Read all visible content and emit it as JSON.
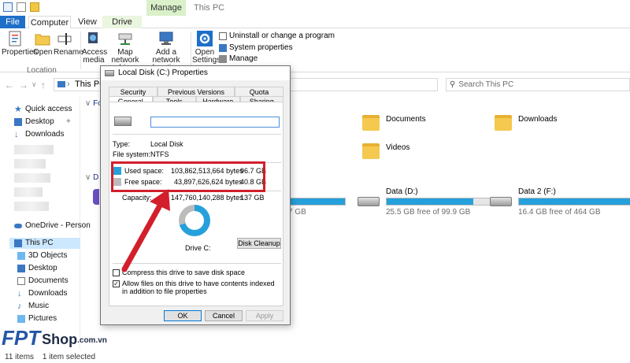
{
  "window": {
    "title": "This PC",
    "context_tab": "Manage"
  },
  "ribbon_tabs": {
    "file": "File",
    "computer": "Computer",
    "view": "View",
    "drive_tools": "Drive Tools"
  },
  "ribbon": {
    "properties": "Properties",
    "open": "Open",
    "rename": "Rename",
    "access_media": "Access media",
    "map_network_drive": "Map network drive",
    "add_network_location": "Add a network location",
    "open_settings": "Open Settings",
    "uninstall": "Uninstall or change a program",
    "system_properties": "System properties",
    "manage": "Manage",
    "group_location": "Location"
  },
  "address": {
    "path": "This PC",
    "search_placeholder": "Search This PC"
  },
  "nav": {
    "quick_access": "Quick access",
    "desktop": "Desktop",
    "downloads": "Downloads",
    "onedrive": "OneDrive - Person",
    "this_pc": "This PC",
    "objects3d": "3D Objects",
    "desktop2": "Desktop",
    "documents": "Documents",
    "downloads2": "Downloads",
    "music": "Music",
    "pictures": "Pictures"
  },
  "content": {
    "section_folders": "Fo",
    "section_devices": "D",
    "folder_documents": "Documents",
    "folder_downloads": "Downloads",
    "folder_videos": "Videos"
  },
  "drives": [
    {
      "name": "",
      "free": "7 GB",
      "fill_pct": 70
    },
    {
      "name": "Data (D:)",
      "free": "25.5 GB free of 99.9 GB",
      "fill_pct": 74
    },
    {
      "name": "Data 2 (F:)",
      "free": "16.4 GB free of 464 GB",
      "fill_pct": 96
    }
  ],
  "status": {
    "items": "11 items",
    "selected": "1 item selected"
  },
  "dialog": {
    "title": "Local Disk (C:) Properties",
    "tabs_top": [
      "Security",
      "Previous Versions",
      "Quota"
    ],
    "tabs_bottom": [
      "General",
      "Tools",
      "Hardware",
      "Sharing"
    ],
    "name_value": "",
    "type_label": "Type:",
    "type_value": "Local Disk",
    "fs_label": "File system:",
    "fs_value": "NTFS",
    "used_label": "Used space:",
    "used_bytes": "103,862,513,664 bytes",
    "used_gb": "96.7 GB",
    "free_label": "Free space:",
    "free_bytes": "43,897,626,624 bytes",
    "free_gb": "40.8 GB",
    "capacity_label": "Capacity:",
    "capacity_bytes": "147,760,140,288 bytes",
    "capacity_gb": "137 GB",
    "drive_label": "Drive C:",
    "disk_cleanup": "Disk Cleanup",
    "compress": "Compress this drive to save disk space",
    "index": "Allow files on this drive to have contents indexed in addition to file properties",
    "ok": "OK",
    "cancel": "Cancel",
    "apply": "Apply",
    "used_fraction": 0.703,
    "colors": {
      "used": "#26a0da",
      "free": "#bcbcbc",
      "highlight": "#d21f2b"
    }
  },
  "watermark": {
    "fpt": "FPT",
    "shop": "Shop",
    "domain": ".com.vn"
  }
}
